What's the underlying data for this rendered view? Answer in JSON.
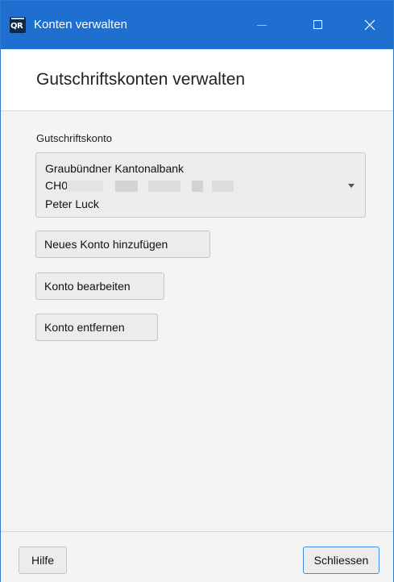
{
  "window": {
    "title": "Konten verwalten",
    "app_icon": "qr-bill-app-icon",
    "accent_color": "#1f6fd1"
  },
  "header": {
    "title": "Gutschriftskonten verwalten"
  },
  "account": {
    "label": "Gutschriftskonto",
    "selected": {
      "bank": "Graubündner Kantonalbank",
      "iban_prefix": "CH09",
      "holder": "Peter Luck"
    }
  },
  "actions": {
    "add_label": "Neues Konto hinzufügen",
    "edit_label": "Konto bearbeiten",
    "remove_label": "Konto entfernen"
  },
  "footer": {
    "help_label": "Hilfe",
    "close_label": "Schliessen"
  }
}
